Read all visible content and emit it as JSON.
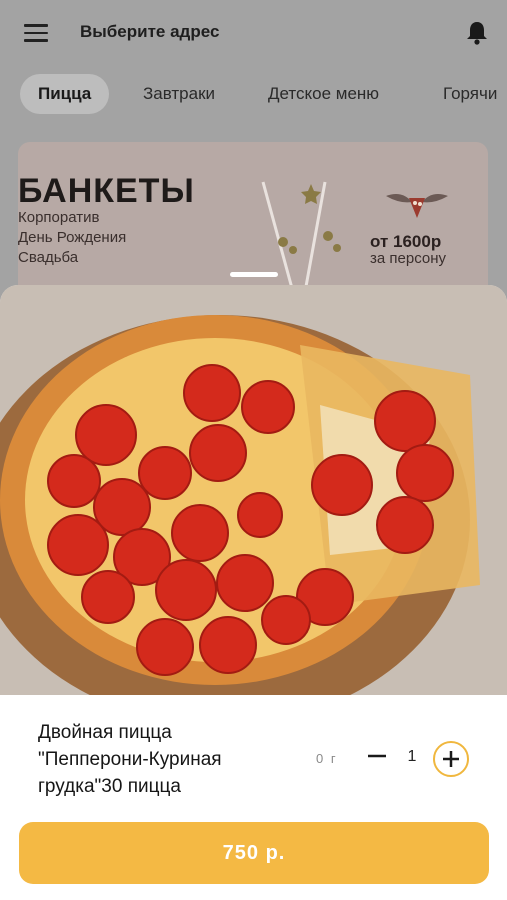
{
  "header": {
    "title": "Выберите адрес"
  },
  "tabs": [
    {
      "label": "Пицца"
    },
    {
      "label": "Завтраки"
    },
    {
      "label": "Детское меню"
    },
    {
      "label": "Горячи"
    }
  ],
  "banner": {
    "title": "БАНКЕТЫ",
    "lines": [
      "Корпоратив",
      "День Рождения",
      "Свадьба"
    ],
    "price": "от 1600р",
    "price_sub": "за персону"
  },
  "product": {
    "name_line1": "Двойная пицца",
    "name_line2": "\"Пепперони-Куриная",
    "name_line3": "грудка\"30 пицца",
    "weight": "0 г",
    "quantity": "1",
    "price_button": "750 р."
  },
  "colors": {
    "accent": "#f4b944",
    "overlay": "#a3a3a3"
  }
}
